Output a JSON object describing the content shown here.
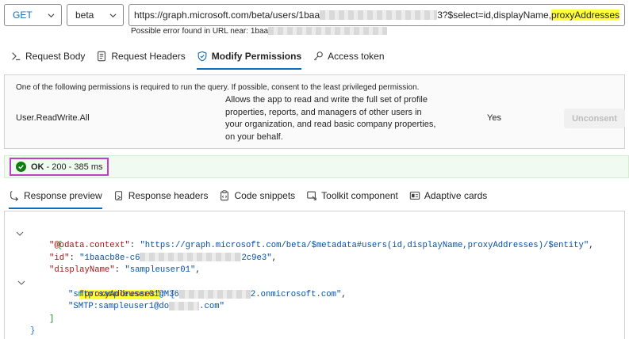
{
  "request": {
    "method": "GET",
    "version": "beta",
    "url_prefix": "https://graph.microsoft.com/beta/users/1baa",
    "url_mid": "3?$select=id,displayName,",
    "url_highlight": "proxyAddresses",
    "warning_prefix": "Possible error found in URL near: 1baa"
  },
  "request_tabs": [
    {
      "label": "Request Body",
      "icon": "play-icon"
    },
    {
      "label": "Request Headers",
      "icon": "document-icon"
    },
    {
      "label": "Modify Permissions",
      "icon": "shield-icon"
    },
    {
      "label": "Access token",
      "icon": "key-icon"
    }
  ],
  "permissions": {
    "heading": "One of the following permissions is required to run the query. If possible, consent to the least privileged permission.",
    "name": "User.ReadWrite.All",
    "description": "Allows the app to read and write the full set of profile properties, reports, and managers of other users in your organization, and read basic company properties, on your behalf.",
    "admin_consent": "Yes",
    "consent_button": "Unconsent"
  },
  "status": {
    "ok": "OK",
    "detail": " - 200 - 385 ms"
  },
  "response_tabs": [
    {
      "label": "Response preview",
      "icon": "preview-icon"
    },
    {
      "label": "Response headers",
      "icon": "headers-icon"
    },
    {
      "label": "Code snippets",
      "icon": "clipboard-icon"
    },
    {
      "label": "Toolkit component",
      "icon": "toolkit-icon"
    },
    {
      "label": "Adaptive cards",
      "icon": "cards-icon"
    }
  ],
  "response": {
    "open_brace": "{",
    "context_key": "\"@odata.context\"",
    "context_val": "\"https://graph.microsoft.com/beta/$metadata#users(id,displayName,proxyAddresses)/$entity\"",
    "id_key": "\"id\"",
    "id_val_start": "\"1baacb8e-c6",
    "id_val_end": "2c9e3\"",
    "name_key": "\"displayName\"",
    "name_val": "\"sampleuser01\"",
    "proxy_key": "\"proxyAddresses\"",
    "addr1_start": "\"smtp:sampleuser01@M36",
    "addr1_end": "2.onmicrosoft.com\"",
    "addr2_start": "\"SMTP:sampleuser1@do",
    "addr2_end": ".com\"",
    "close_bracket": "]",
    "close_brace": "}"
  },
  "colors": {
    "accent": "#0f6cbd",
    "success": "#107c10",
    "highlight_outline": "#c13ec7",
    "highlight": "#ffff3a"
  }
}
